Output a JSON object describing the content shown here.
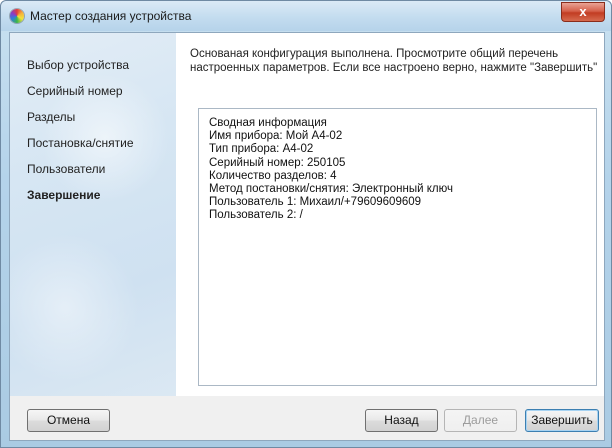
{
  "window": {
    "title": "Мастер создания устройства",
    "close_label": "x"
  },
  "sidebar": {
    "items": [
      {
        "label": "Выбор устройства",
        "active": false
      },
      {
        "label": "Серийный номер",
        "active": false
      },
      {
        "label": "Разделы",
        "active": false
      },
      {
        "label": "Постановка/снятие",
        "active": false
      },
      {
        "label": "Пользователи",
        "active": false
      },
      {
        "label": "Завершение",
        "active": true
      }
    ]
  },
  "main": {
    "description_line1": "Основаная конфигурация выполнена. Просмотрите общий перечень",
    "description_line2": "настроенных параметров. Если все настроено верно, нажмите \"Завершить\"",
    "summary": [
      "Сводная информация",
      "Имя прибора: Мой А4-02",
      "Тип прибора: А4-02",
      "Серийный номер: 250105",
      "Количество разделов: 4",
      "Метод постановки/снятия: Электронный ключ",
      "Пользователь 1: Михаил/+79609609609",
      "Пользователь 2: /"
    ]
  },
  "footer": {
    "cancel_label": "Отмена",
    "back_label": "Назад",
    "next_label": "Далее",
    "finish_label": "Завершить"
  }
}
